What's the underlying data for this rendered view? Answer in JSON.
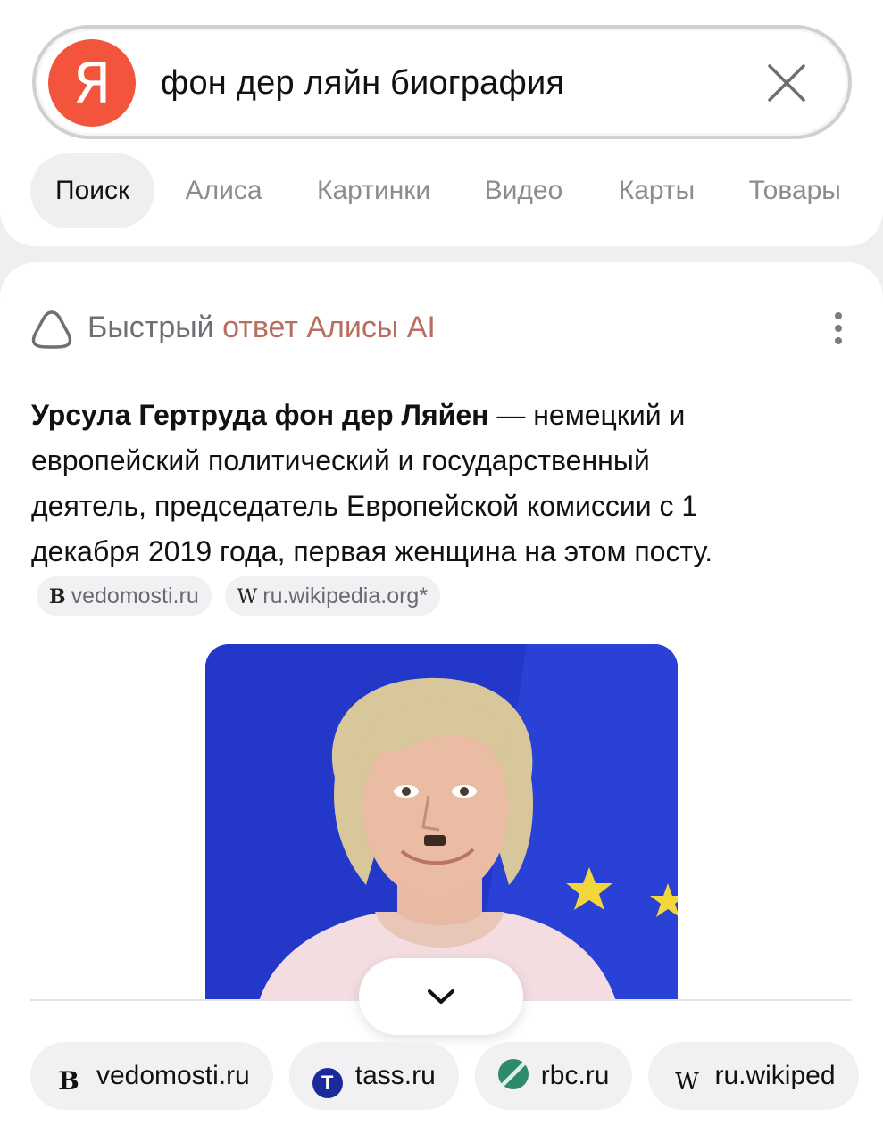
{
  "search": {
    "logo_letter": "Я",
    "query": "фон дер ляйн биография"
  },
  "tabs": [
    {
      "label": "Поиск",
      "active": true
    },
    {
      "label": "Алиса",
      "active": false
    },
    {
      "label": "Картинки",
      "active": false
    },
    {
      "label": "Видео",
      "active": false
    },
    {
      "label": "Карты",
      "active": false
    },
    {
      "label": "Товары",
      "active": false
    }
  ],
  "ai_answer": {
    "title_prefix": "Быстрый",
    "title_accent": "ответ Алисы AI",
    "name_bold": "Урсула Гертруда фон дер Ляйен",
    "text": " — немецкий и европейский политический и государственный деятель, председатель Европейской комиссии с 1 декабря 2019 года, первая женщина на этом посту.",
    "inline_sources": [
      {
        "icon": "B",
        "label": "vedomosti.ru"
      },
      {
        "icon": "W",
        "label": "ru.wikipedia.org*"
      }
    ]
  },
  "sources": [
    {
      "icon": "B",
      "label": "vedomosti.ru"
    },
    {
      "icon": "T",
      "label": "tass.ru"
    },
    {
      "icon": "",
      "label": "rbc.ru"
    },
    {
      "icon": "W",
      "label": "ru.wikiped"
    }
  ],
  "colors": {
    "brand": "#f2553b",
    "accent_text": "#b86d5e",
    "photo_background": "#2338c9"
  }
}
